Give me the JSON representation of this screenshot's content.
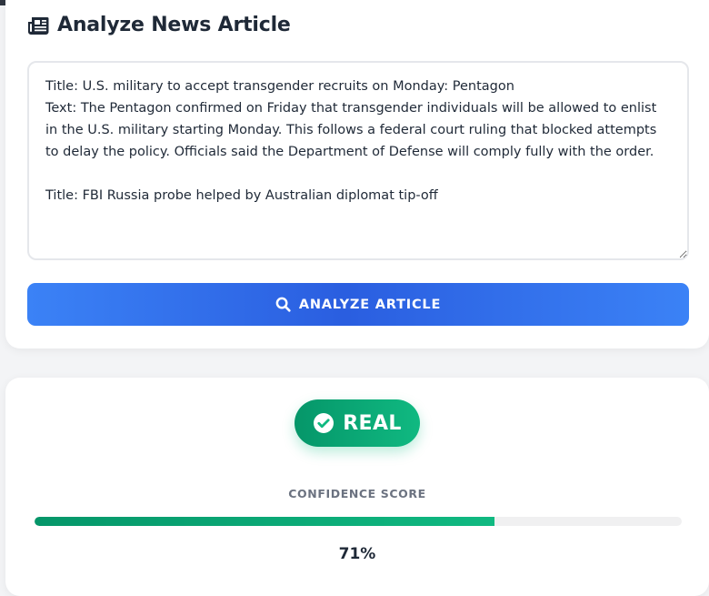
{
  "analyze": {
    "title": "Analyze News Article",
    "title_icon": "newspaper-icon",
    "article_text": "Title: U.S. military to accept transgender recruits on Monday: Pentagon\nText: The Pentagon confirmed on Friday that transgender individuals will be allowed to enlist in the U.S. military starting Monday. This follows a federal court ruling that blocked attempts to delay the policy. Officials said the Department of Defense will comply fully with the order.\n\nTitle: FBI Russia probe helped by Australian diplomat tip-off",
    "button_label": "ANALYZE ARTICLE",
    "button_icon": "search-icon",
    "button_color": "#3b82f6"
  },
  "result": {
    "verdict": "REAL",
    "verdict_icon": "check-circle-icon",
    "verdict_color": "#10b981",
    "confidence_label": "CONFIDENCE SCORE",
    "confidence_percent": 71,
    "confidence_text": "71%"
  }
}
